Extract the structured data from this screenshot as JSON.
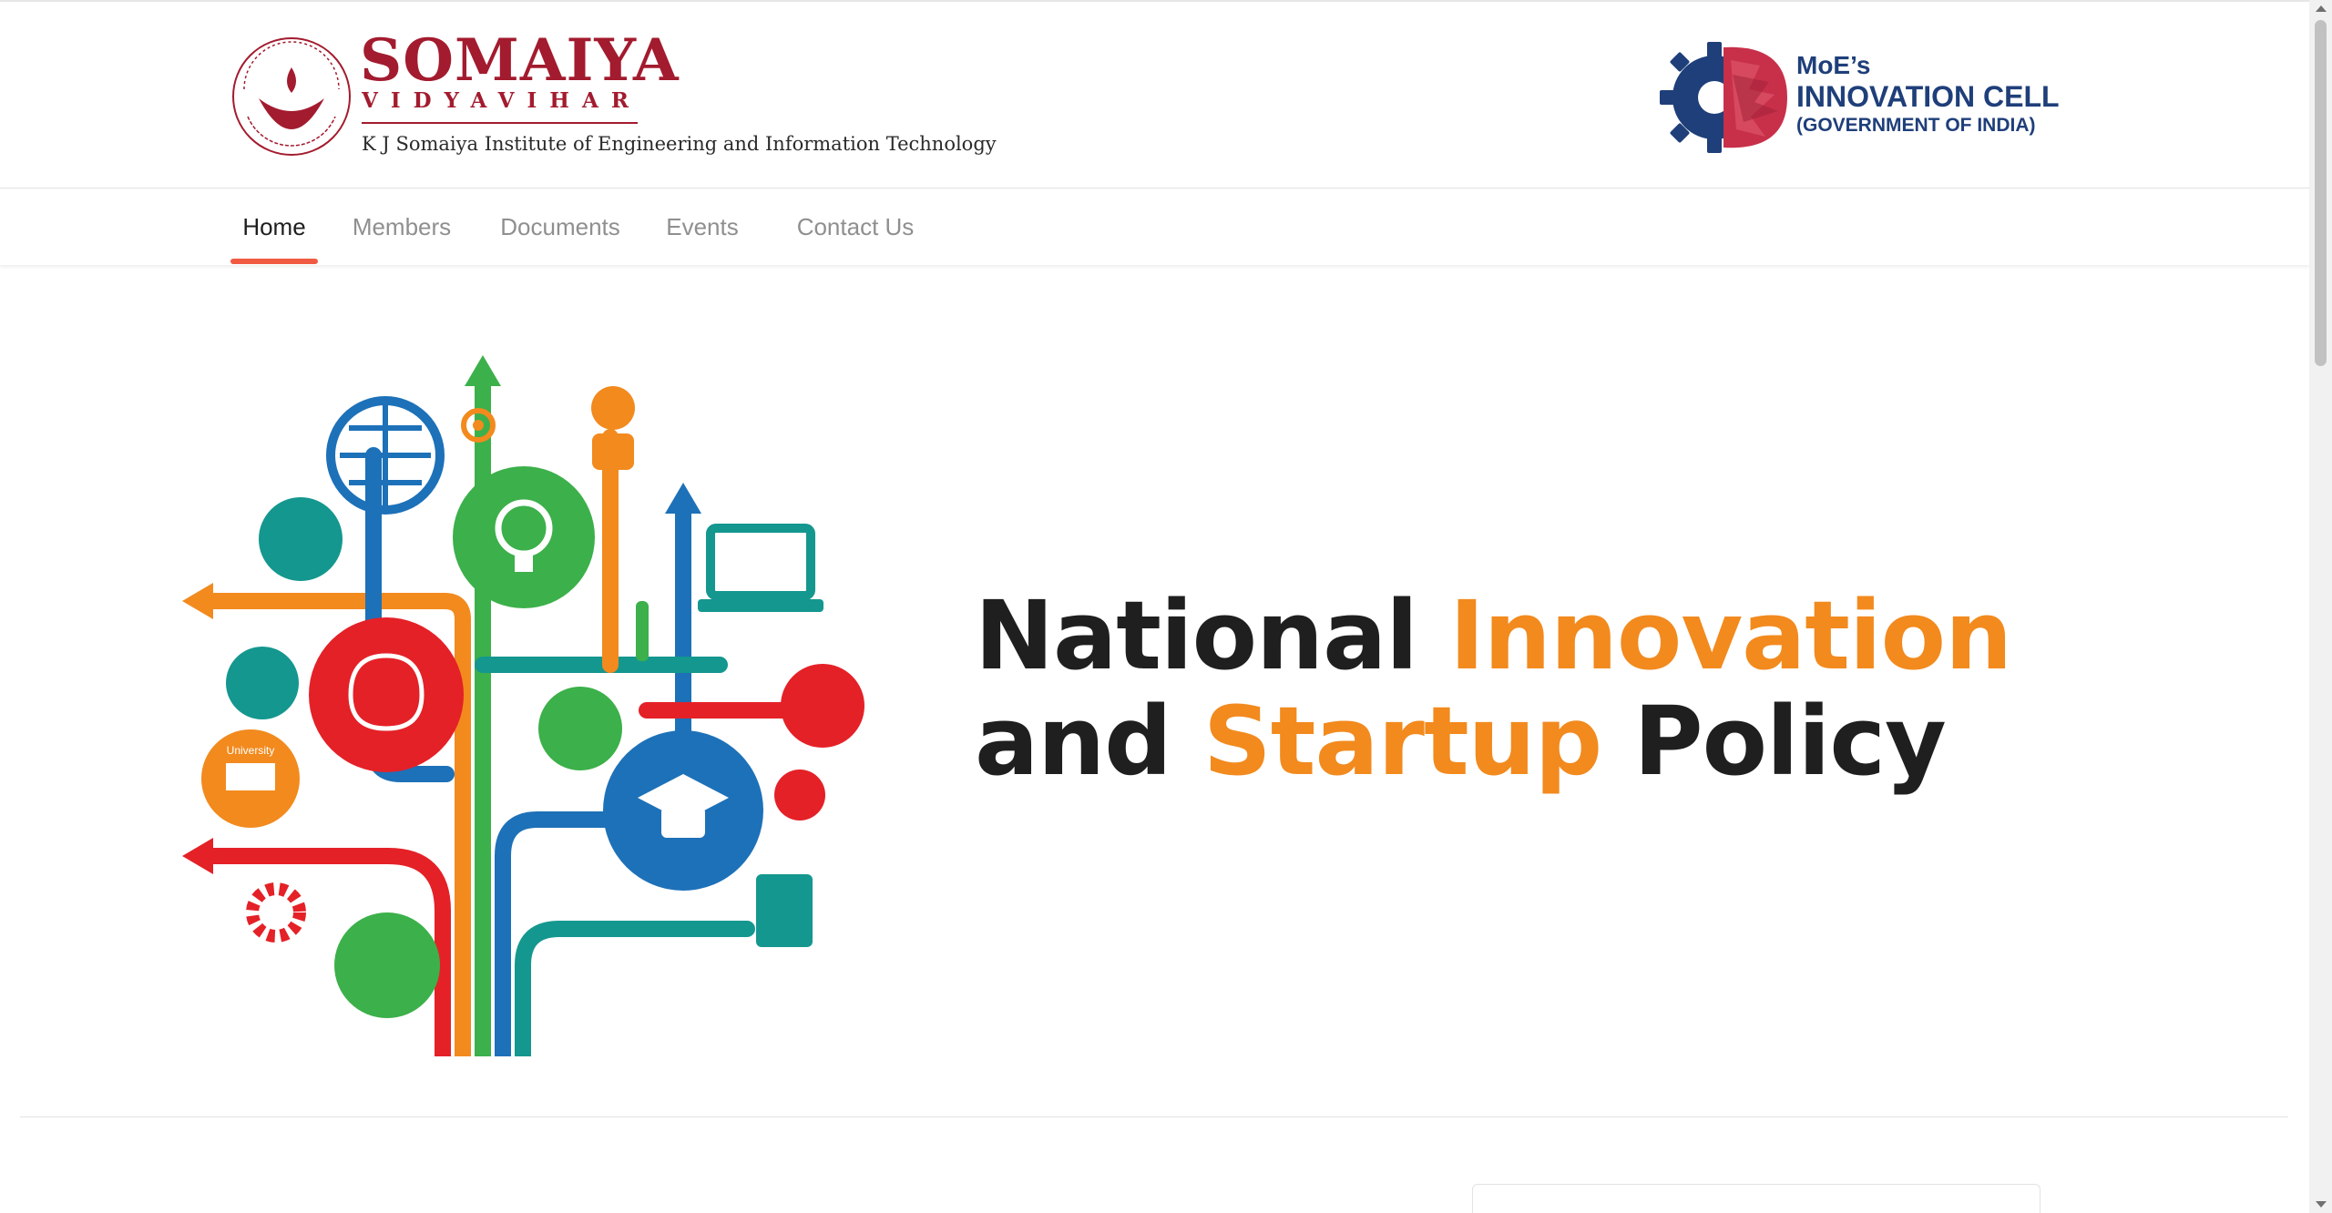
{
  "header": {
    "somaiya": {
      "title": "SOMAIYA",
      "subtitle": "VIDYAVIHAR",
      "institute": "K J Somaiya Institute of Engineering and Information Technology",
      "logo_ring_text": "Knowledge Alone Liberates",
      "logo_bottom_text": "Somaiya Vidyavihar"
    },
    "moe": {
      "line1": "MoE’s",
      "line2": "INNOVATION CELL",
      "line3": "(GOVERNMENT OF INDIA)"
    }
  },
  "nav": {
    "items": [
      {
        "label": "Home",
        "active": true
      },
      {
        "label": "Members",
        "active": false
      },
      {
        "label": "Documents",
        "active": false
      },
      {
        "label": "Events",
        "active": false
      },
      {
        "label": "Contact Us",
        "active": false
      }
    ]
  },
  "hero": {
    "title_parts": [
      "National ",
      "Innovation",
      "and ",
      "Startup",
      " Policy"
    ],
    "art_label": "University"
  },
  "colors": {
    "brand_red": "#a31b2e",
    "moe_blue": "#1f3f7a",
    "accent_orange": "#f28a1e",
    "nav_active_underline": "#f15a42",
    "dark_text": "#1f1f1f"
  },
  "icons": [
    "somaiya-logo",
    "moe-innovation-cell-logo",
    "innovation-tree-illustration"
  ]
}
